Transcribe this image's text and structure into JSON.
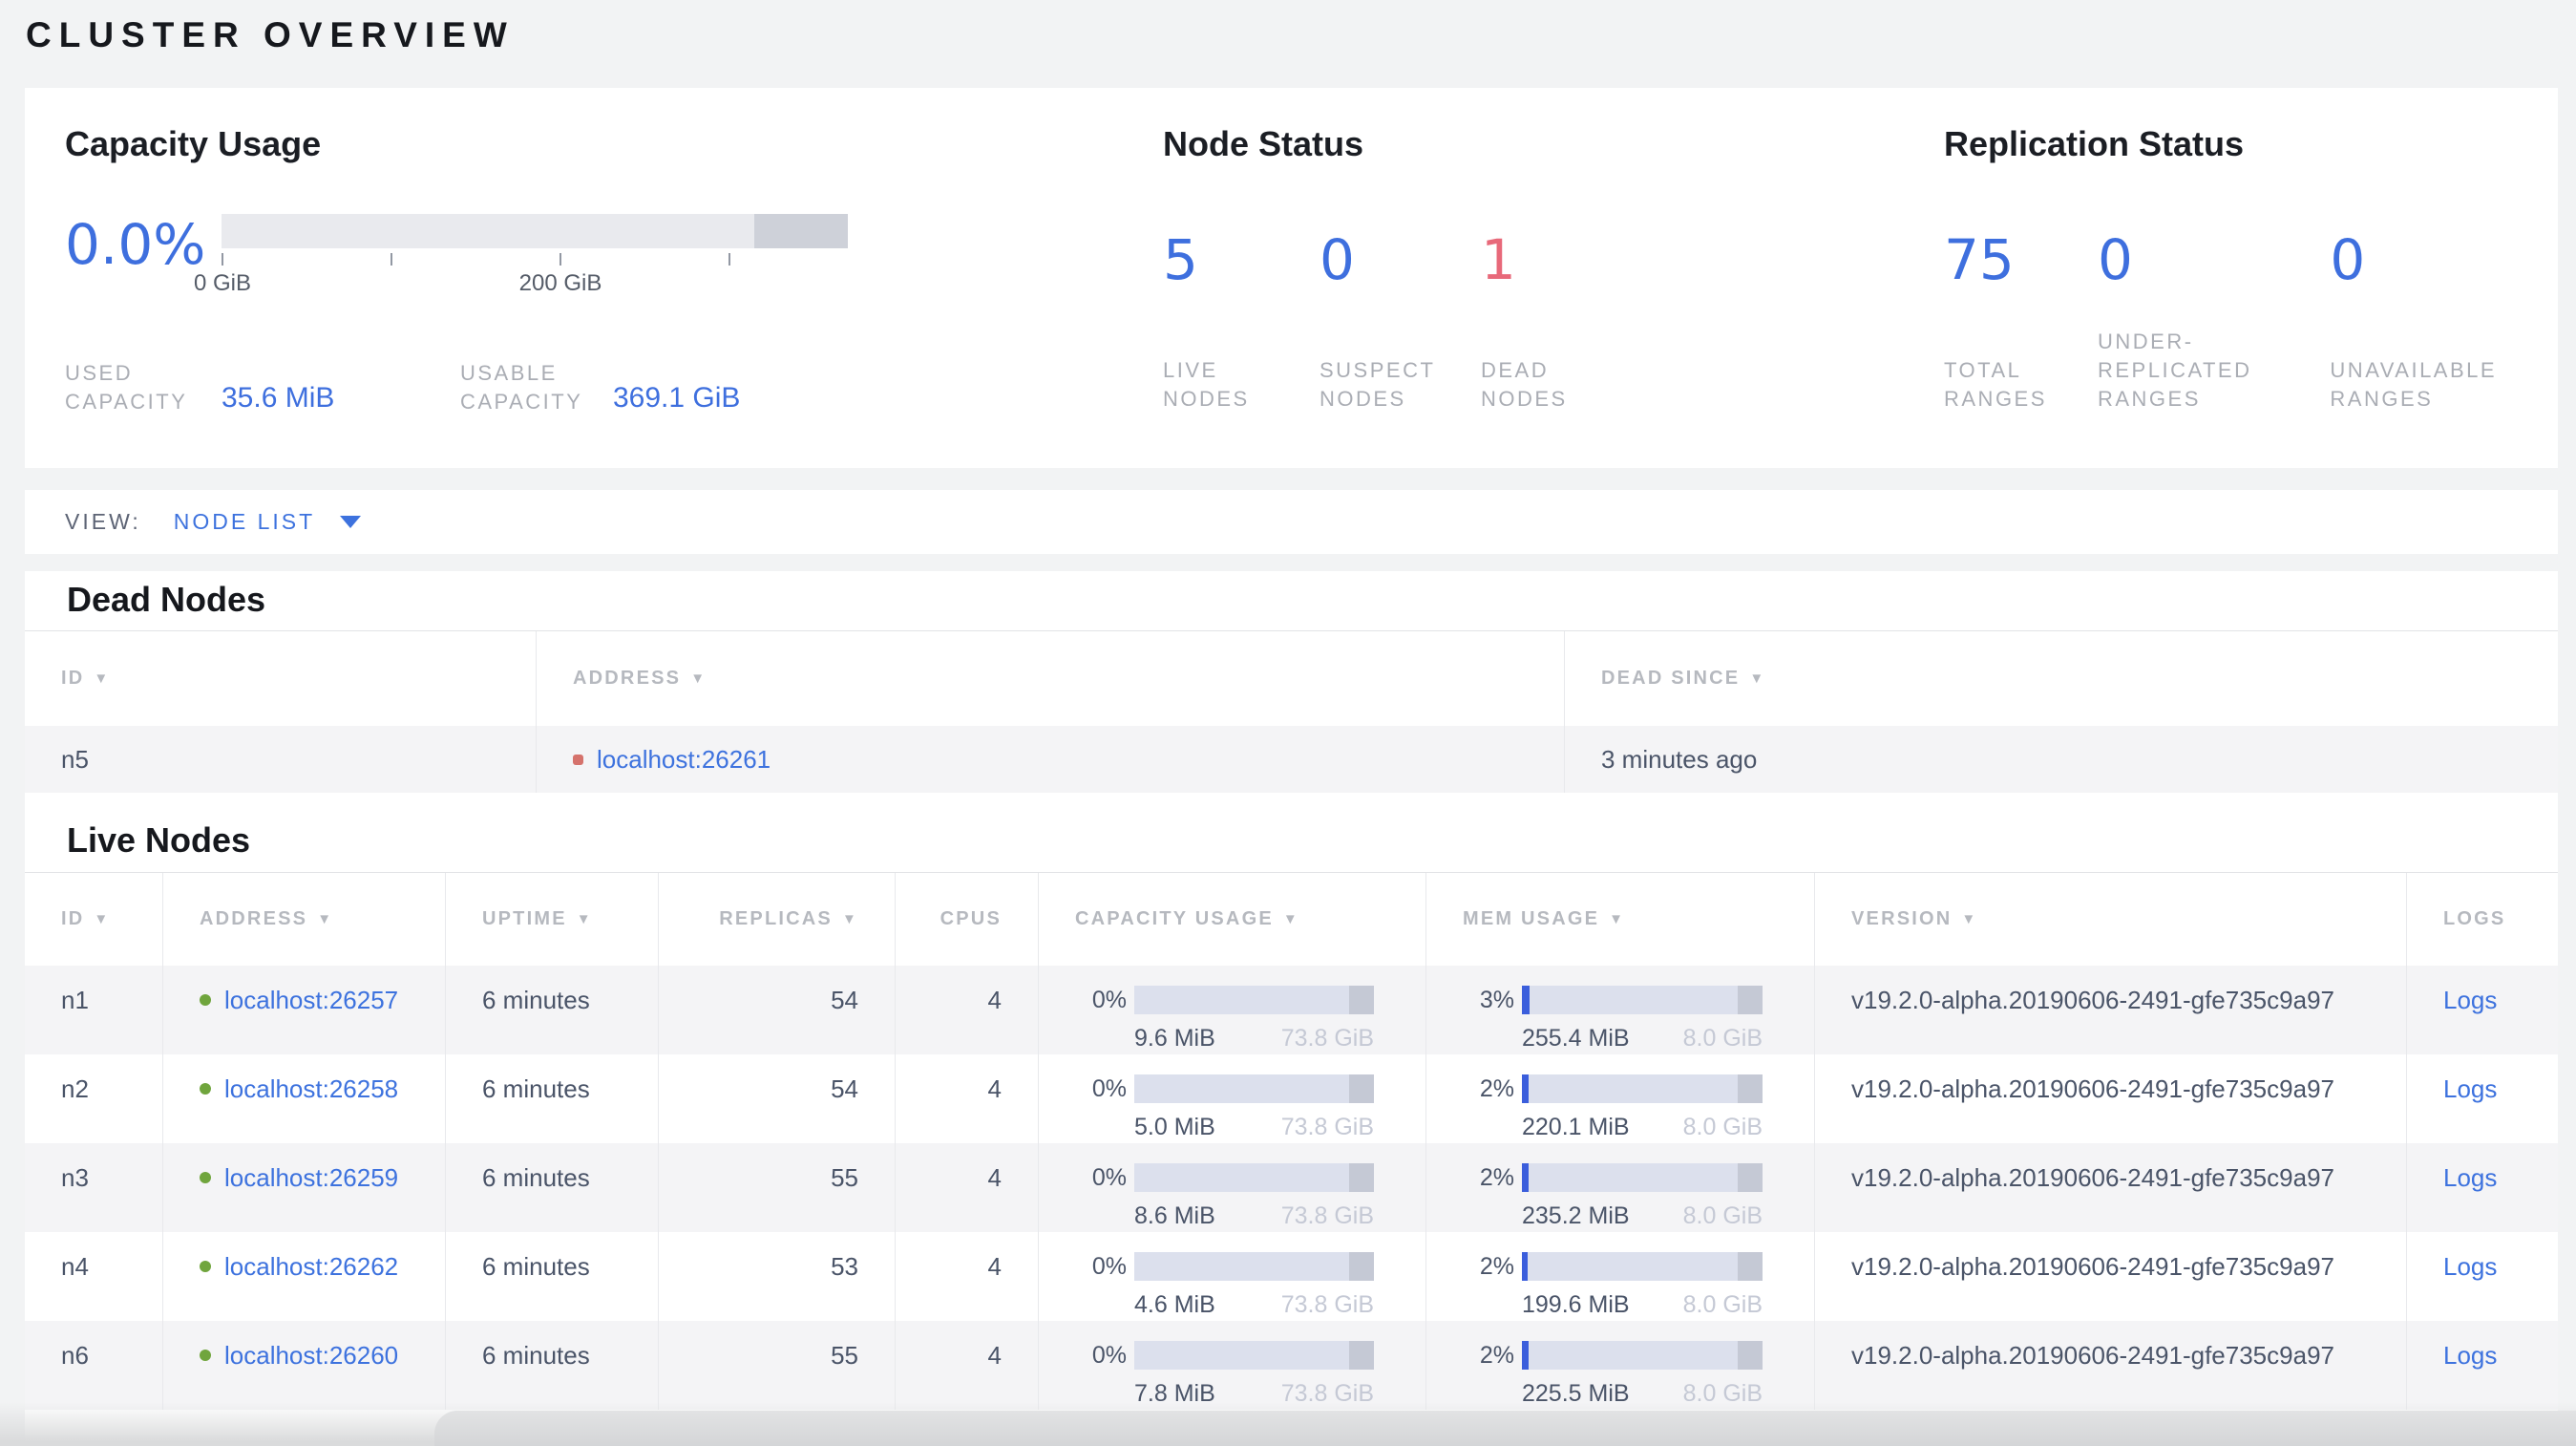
{
  "page_title": "CLUSTER OVERVIEW",
  "icons": {
    "sort_arrow": "▼",
    "dropdown_caret": "▼",
    "live_dot": "green-circle",
    "dead_dot": "red-square"
  },
  "colors": {
    "accent_blue": "#3e6fde",
    "link_blue": "#3d72de",
    "dead_red": "#e8697a",
    "live_dot_green": "#70a53d",
    "dead_dot_red": "#d5726c",
    "bar_track": "#dce0ed",
    "bar_fill_blue": "#3b5edc",
    "bar_reserved_gray": "#c5c9d5"
  },
  "summary": {
    "capacity": {
      "heading": "Capacity Usage",
      "percent": "0.0%",
      "bar": {
        "reserved_start_pct": 85,
        "tick_labels": [
          "0 GiB",
          "200 GiB"
        ],
        "tick_values_gib": [
          0,
          100,
          200,
          300
        ]
      },
      "stats": [
        {
          "label": "USED\nCAPACITY",
          "value": "35.6 MiB"
        },
        {
          "label": "USABLE\nCAPACITY",
          "value": "369.1 GiB"
        }
      ]
    },
    "node_status": {
      "heading": "Node Status",
      "stats": [
        {
          "value": "5",
          "label": "LIVE\nNODES"
        },
        {
          "value": "0",
          "label": "SUSPECT\nNODES"
        },
        {
          "value": "1",
          "label": "DEAD\nNODES"
        }
      ]
    },
    "replication": {
      "heading": "Replication Status",
      "stats": [
        {
          "value": "75",
          "label": "TOTAL\nRANGES"
        },
        {
          "value": "0",
          "label": "UNDER-\nREPLICATED\nRANGES"
        },
        {
          "value": "0",
          "label": "UNAVAILABLE\nRANGES"
        }
      ]
    }
  },
  "view_bar": {
    "label": "VIEW:",
    "selected": "NODE LIST"
  },
  "dead_nodes": {
    "heading": "Dead Nodes",
    "columns": [
      {
        "label": "ID",
        "sortable": true
      },
      {
        "label": "ADDRESS",
        "sortable": true
      },
      {
        "label": "DEAD SINCE",
        "sortable": true
      }
    ],
    "rows": [
      {
        "id": "n5",
        "address": "localhost:26261",
        "dead_since": "3 minutes ago"
      }
    ]
  },
  "live_nodes": {
    "heading": "Live Nodes",
    "columns": [
      {
        "label": "ID",
        "sortable": true
      },
      {
        "label": "ADDRESS",
        "sortable": true
      },
      {
        "label": "UPTIME",
        "sortable": true
      },
      {
        "label": "REPLICAS",
        "sortable": true
      },
      {
        "label": "CPUS",
        "sortable": false
      },
      {
        "label": "CAPACITY USAGE",
        "sortable": true
      },
      {
        "label": "MEM USAGE",
        "sortable": true
      },
      {
        "label": "VERSION",
        "sortable": true
      },
      {
        "label": "LOGS",
        "sortable": false
      }
    ],
    "rows": [
      {
        "id": "n1",
        "address": "localhost:26257",
        "uptime": "6 minutes",
        "replicas": "54",
        "cpus": "4",
        "capacity": {
          "pct": "0%",
          "fill_pct": 0,
          "used": "9.6 MiB",
          "total": "73.8 GiB"
        },
        "memory": {
          "pct": "3%",
          "fill_pct": 3,
          "used": "255.4 MiB",
          "total": "8.0 GiB"
        },
        "version": "v19.2.0-alpha.20190606-2491-gfe735c9a97",
        "logs_label": "Logs"
      },
      {
        "id": "n2",
        "address": "localhost:26258",
        "uptime": "6 minutes",
        "replicas": "54",
        "cpus": "4",
        "capacity": {
          "pct": "0%",
          "fill_pct": 0,
          "used": "5.0 MiB",
          "total": "73.8 GiB"
        },
        "memory": {
          "pct": "2%",
          "fill_pct": 2.7,
          "used": "220.1 MiB",
          "total": "8.0 GiB"
        },
        "version": "v19.2.0-alpha.20190606-2491-gfe735c9a97",
        "logs_label": "Logs"
      },
      {
        "id": "n3",
        "address": "localhost:26259",
        "uptime": "6 minutes",
        "replicas": "55",
        "cpus": "4",
        "capacity": {
          "pct": "0%",
          "fill_pct": 0,
          "used": "8.6 MiB",
          "total": "73.8 GiB"
        },
        "memory": {
          "pct": "2%",
          "fill_pct": 2.9,
          "used": "235.2 MiB",
          "total": "8.0 GiB"
        },
        "version": "v19.2.0-alpha.20190606-2491-gfe735c9a97",
        "logs_label": "Logs"
      },
      {
        "id": "n4",
        "address": "localhost:26262",
        "uptime": "6 minutes",
        "replicas": "53",
        "cpus": "4",
        "capacity": {
          "pct": "0%",
          "fill_pct": 0,
          "used": "4.6 MiB",
          "total": "73.8 GiB"
        },
        "memory": {
          "pct": "2%",
          "fill_pct": 2.4,
          "used": "199.6 MiB",
          "total": "8.0 GiB"
        },
        "version": "v19.2.0-alpha.20190606-2491-gfe735c9a97",
        "logs_label": "Logs"
      },
      {
        "id": "n6",
        "address": "localhost:26260",
        "uptime": "6 minutes",
        "replicas": "55",
        "cpus": "4",
        "capacity": {
          "pct": "0%",
          "fill_pct": 0,
          "used": "7.8 MiB",
          "total": "73.8 GiB"
        },
        "memory": {
          "pct": "2%",
          "fill_pct": 2.8,
          "used": "225.5 MiB",
          "total": "8.0 GiB"
        },
        "version": "v19.2.0-alpha.20190606-2491-gfe735c9a97",
        "logs_label": "Logs"
      }
    ]
  }
}
